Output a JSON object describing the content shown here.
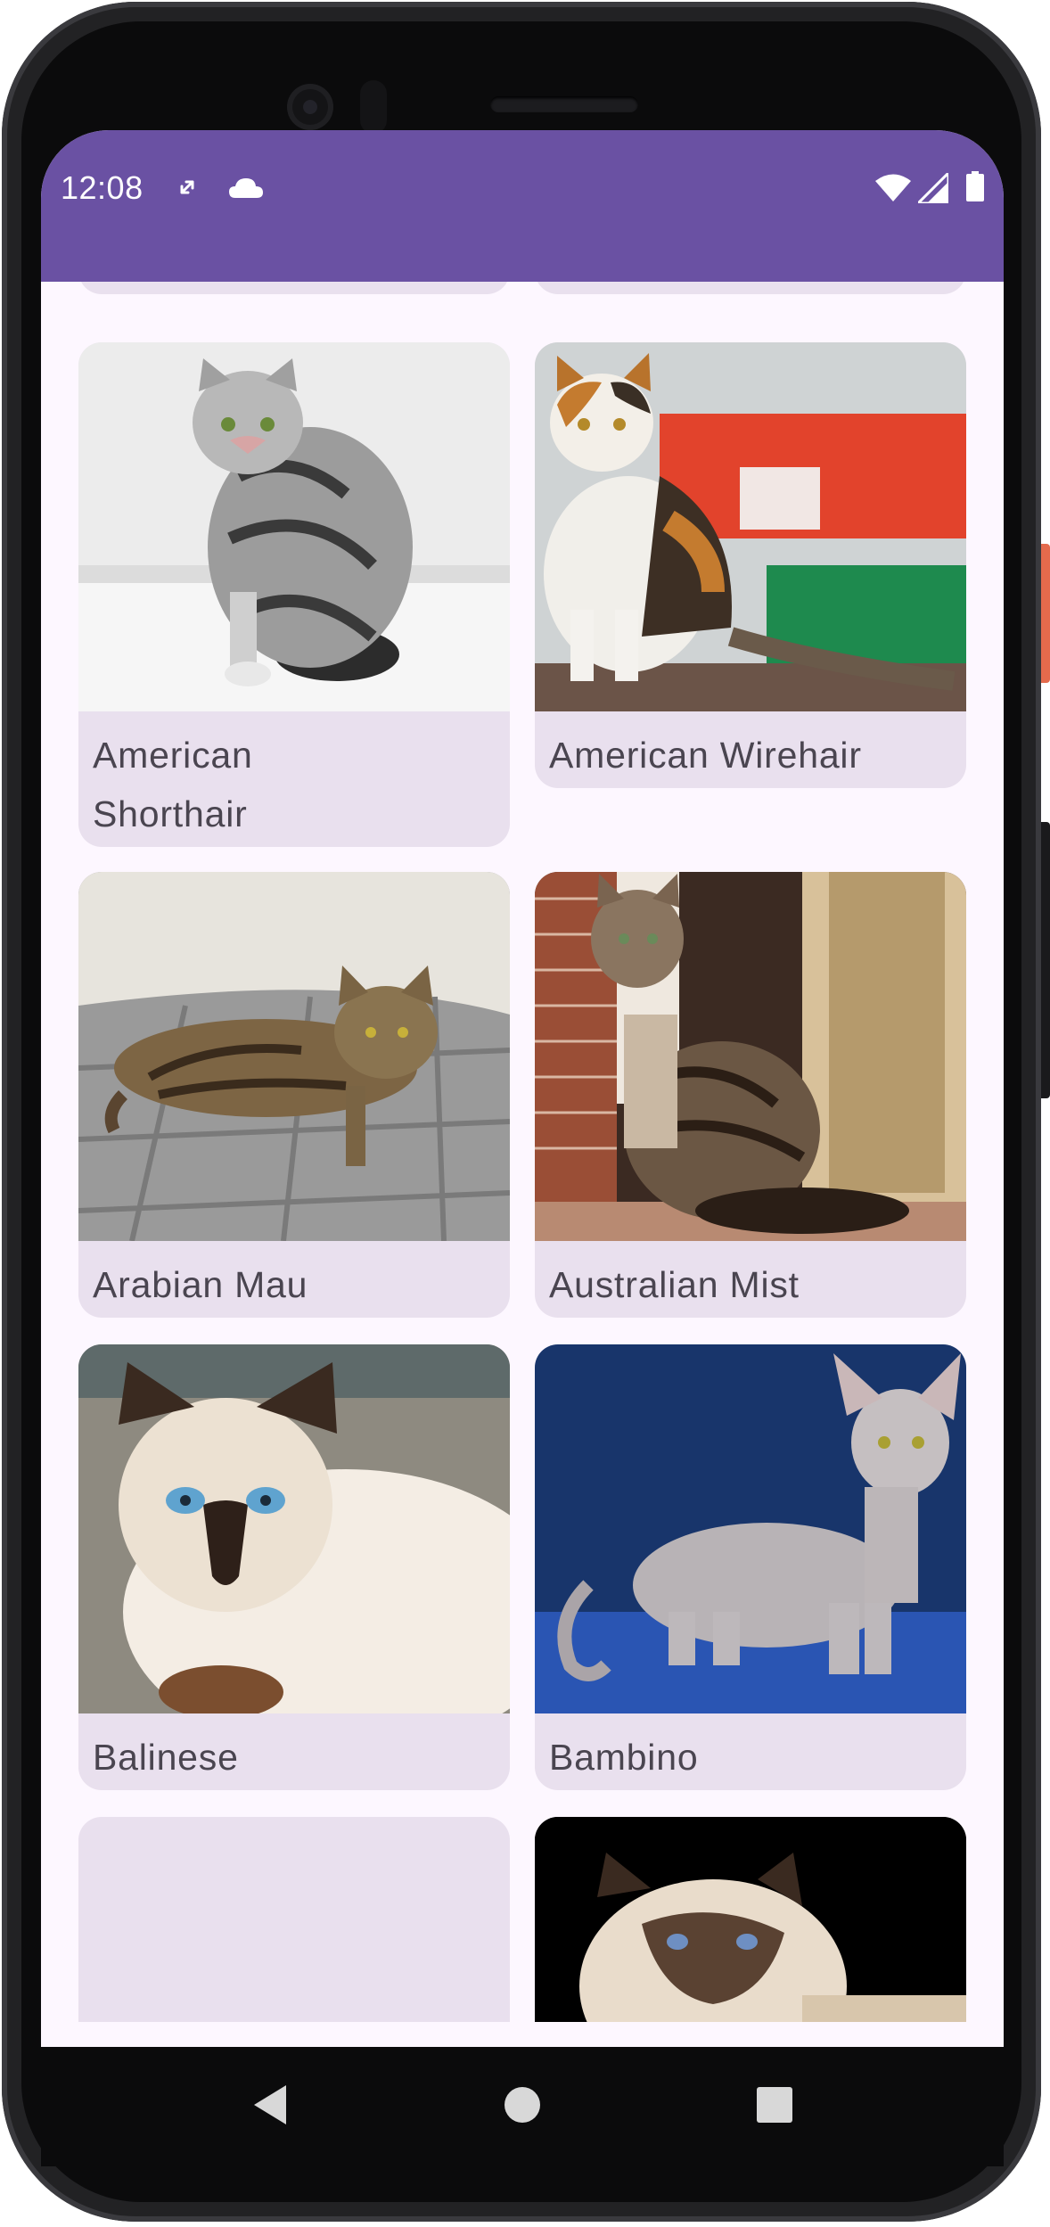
{
  "status_bar": {
    "time": "12:08",
    "background": "#6a51a3",
    "icons": [
      "sync-icon",
      "cloud-icon",
      "wifi-icon",
      "signal-icon",
      "battery-icon"
    ]
  },
  "cats": [
    {
      "name": "American Shorthair",
      "label_lines": [
        "American",
        "Shorthair"
      ]
    },
    {
      "name": "American Wirehair"
    },
    {
      "name": "Arabian Mau"
    },
    {
      "name": "Australian Mist"
    },
    {
      "name": "Balinese"
    },
    {
      "name": "Bambino"
    }
  ],
  "navigation": {
    "buttons": [
      "back-button",
      "home-button",
      "recents-button"
    ]
  }
}
